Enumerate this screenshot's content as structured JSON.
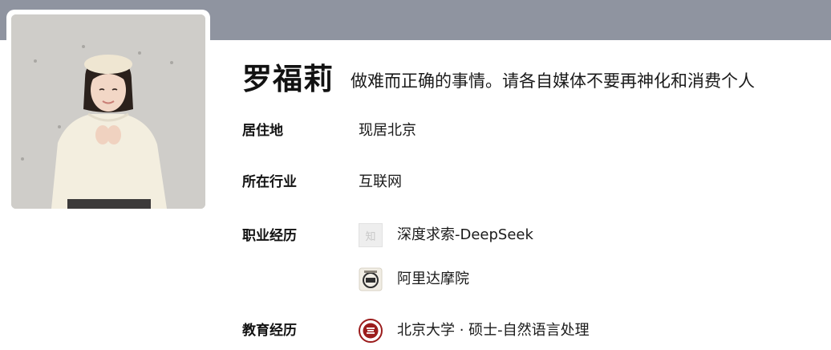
{
  "profile": {
    "name": "罗福莉",
    "headline": "做难而正确的事情。请各自媒体不要再神化和消费个人"
  },
  "fields": {
    "residence": {
      "label": "居住地",
      "value": "现居北京"
    },
    "industry": {
      "label": "所在行业",
      "value": "互联网"
    },
    "career": {
      "label": "职业经历",
      "items": [
        {
          "name": "深度求索-DeepSeek",
          "icon": "zhihu-placeholder-icon",
          "icon_char": "知"
        },
        {
          "name": "阿里达摩院",
          "icon": "damo-academy-logo"
        }
      ]
    },
    "education": {
      "label": "教育经历",
      "items": [
        {
          "name": "北京大学 · 硕士-自然语言处理",
          "icon": "pku-emblem"
        }
      ]
    }
  },
  "colors": {
    "cover": "#8f94a0",
    "pku_red": "#9b1c1c"
  }
}
